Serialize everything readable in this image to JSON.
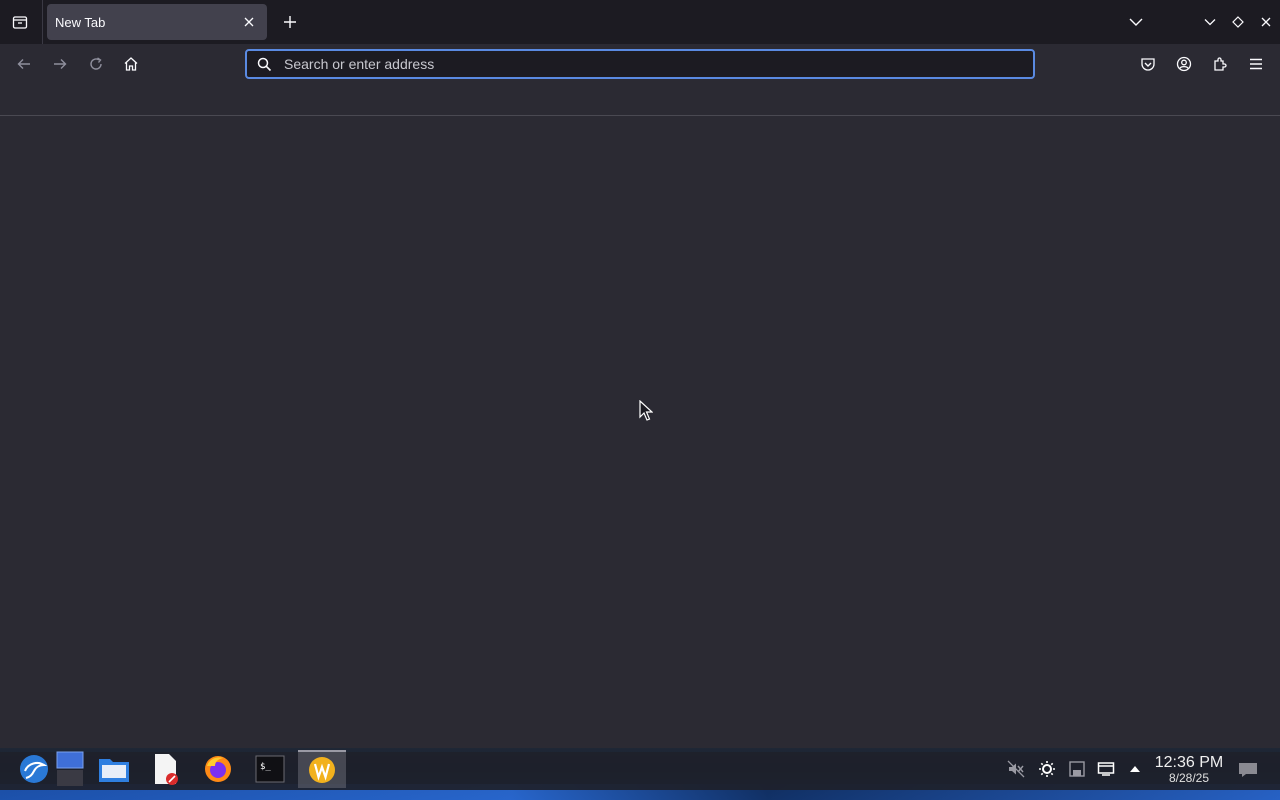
{
  "browser": {
    "tab": {
      "title": "New Tab"
    },
    "urlbar": {
      "placeholder": "Search or enter address"
    }
  },
  "taskbar": {
    "apps": [
      "kali-menu",
      "workspace-switcher",
      "file-manager",
      "text-editor",
      "firefox",
      "terminal",
      "weather-app"
    ],
    "active_app": "weather-app",
    "clock": {
      "time": "12:36 PM",
      "date": "8/28/25"
    }
  },
  "colors": {
    "tabbar_bg": "#1c1b22",
    "toolbar_bg": "#2b2a33",
    "active_tab_bg": "#42414d",
    "urlbar_focus": "#5a8ae2"
  }
}
